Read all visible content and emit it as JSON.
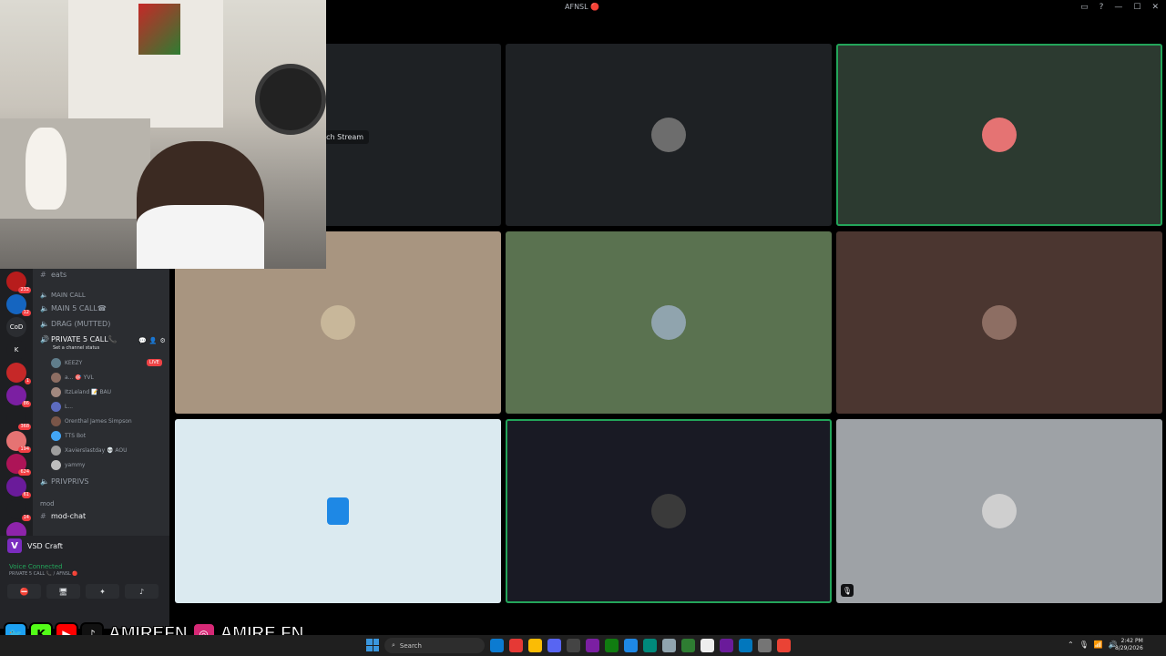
{
  "window": {
    "title": "AFNSL 🔴",
    "controls": [
      "▭",
      "?",
      "—",
      "☐",
      "✕"
    ]
  },
  "webcam": {
    "description_label": "Streamer webcam overlay"
  },
  "guilds": [
    {
      "badge": "232",
      "color": "#b71c1c"
    },
    {
      "badge": "12",
      "color": "#1565c0"
    },
    {
      "label": "CoD",
      "color": "#2b2d31"
    },
    {
      "label": "K",
      "color": "#1e1f22"
    },
    {
      "badge": "1",
      "color": "#c62828"
    },
    {
      "badge": "86",
      "color": "#7b1fa2"
    },
    {
      "badge": "368",
      "color": "#1e1f22"
    },
    {
      "badge": "194",
      "color": "#e57373"
    },
    {
      "badge": "624",
      "color": "#ad1457"
    },
    {
      "badge": "61",
      "color": "#6a1b9a"
    },
    {
      "badge": "14",
      "color": "#1e1f22"
    },
    {
      "badge": "NEW",
      "color": "#8e24aa"
    }
  ],
  "sidebar": {
    "channel_top": "eats",
    "category_main": "MAIN CALL",
    "ch_main5": "MAIN 5 CALL☎",
    "ch_drag": "DRAG (MUTTED)",
    "ch_private": "PRIVATE 5 CALL📞",
    "status_hint": "Set a channel status",
    "live_label": "LIVE",
    "users": [
      {
        "name": "KEEZY",
        "color": "#607d8b"
      },
      {
        "name": "a... 🎯 YVL",
        "color": "#8d6e63"
      },
      {
        "name": "ItzLeland 📝 BAU",
        "color": "#a1887f"
      },
      {
        "name": "L...",
        "color": "#5c6bc0"
      },
      {
        "name": "Orenthal James Simpson",
        "color": "#795548"
      },
      {
        "name": "TTS Bot",
        "color": "#42a5f5"
      },
      {
        "name": "Xavierslastday 💀 AOU",
        "color": "#9e9e9e"
      },
      {
        "name": "yammy",
        "color": "#bdbdbd"
      }
    ],
    "ch_privprivs": "PRIVPRIVS",
    "category_mod": "mod",
    "ch_modchat": "mod-chat"
  },
  "panel": {
    "server_name": "VSD Craft",
    "voice_status": "Voice Connected",
    "voice_sub": "PRIVATE 5 CALL 📞 / AFNSL 🔴"
  },
  "grid": {
    "watch_label": "tch Stream",
    "tiles": [
      {
        "bg": "#1e2124",
        "speaking": false
      },
      {
        "bg": "#1e2124",
        "speaking": false,
        "avatar": "#6d6d6d"
      },
      {
        "bg": "#2c3a30",
        "speaking": true,
        "avatar": "#e57373"
      },
      {
        "bg": "#a89580",
        "speaking": false,
        "avatar": "#c8b79a"
      },
      {
        "bg": "#5a7250",
        "speaking": false,
        "avatar": "#90a4ae"
      },
      {
        "bg": "#4b3630",
        "speaking": false,
        "avatar": "#8d6e63"
      },
      {
        "bg": "#dbeaf0",
        "speaking": false,
        "avatar": "#1e88e5"
      },
      {
        "bg": "#191a24",
        "speaking": true,
        "avatar": "#3a3a3a"
      },
      {
        "bg": "#9ea2a6",
        "speaking": false,
        "avatar": "#cfcfcf"
      }
    ]
  },
  "overlay": {
    "handle1": "AMIREFN",
    "handle2": "AMIRE.FN"
  },
  "taskbar": {
    "search_placeholder": "Search",
    "time": "2:42 PM",
    "date": "8/29/2026"
  }
}
